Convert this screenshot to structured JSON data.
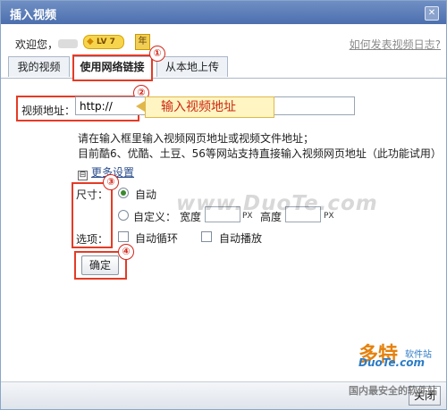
{
  "dialog": {
    "title": "插入视频",
    "close_glyph": "✕"
  },
  "header": {
    "welcome": "欢迎您，",
    "level_badge": "LV 7",
    "vip_label": "年",
    "help_link": "如何发表视频日志?"
  },
  "tabs": [
    {
      "label": "我的视频"
    },
    {
      "label": "使用网络链接",
      "active": true
    },
    {
      "label": "从本地上传"
    }
  ],
  "markers": [
    "①",
    "②",
    "③",
    "④"
  ],
  "url_field": {
    "label": "视频地址：",
    "value": "http://",
    "callout": "输入视频地址"
  },
  "hints": [
    "请在输入框里输入视频网页地址或视频文件地址；",
    "目前酷6、优酷、土豆、56等网站支持直接输入视频网页地址（此功能试用）"
  ],
  "more_settings": {
    "toggle": "⊟",
    "label": "更多设置"
  },
  "size": {
    "label": "尺寸：",
    "auto": "自动",
    "custom": "自定义：",
    "width_label": "宽度",
    "height_label": "高度",
    "unit": "PX"
  },
  "options": {
    "label": "选项：",
    "loop": "自动循环",
    "autoplay": "自动播放"
  },
  "buttons": {
    "ok": "确定",
    "close": "关闭"
  },
  "watermarks": {
    "center": "www.DuoTe.com",
    "logo_main": "多特",
    "logo_tag": "软件站",
    "logo_domain": "DuoTe.com",
    "slogan": "国内最安全的软件站"
  },
  "colors": {
    "title_bar": "#5b7dba",
    "annotation_red": "#e53b25",
    "callout_bg": "#fff5c2",
    "callout_text": "#cc2a14"
  }
}
